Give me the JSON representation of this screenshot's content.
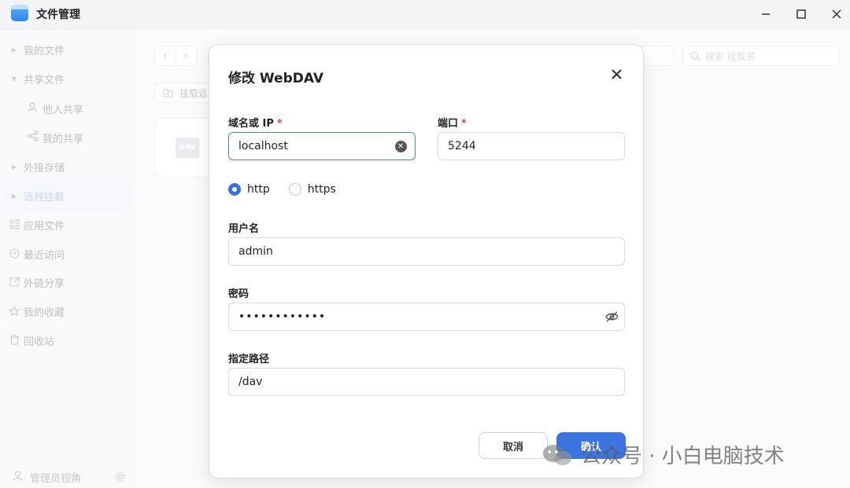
{
  "app": {
    "title": "文件管理"
  },
  "window_controls": {
    "minimize": "—",
    "maximize": "☐",
    "close": "✕"
  },
  "sidebar": {
    "items": [
      {
        "label": "我的文件",
        "icon": "chevron-right-icon",
        "indent": false,
        "active": false
      },
      {
        "label": "共享文件",
        "icon": "chevron-down-icon",
        "indent": false,
        "active": false
      },
      {
        "label": "他人共享",
        "icon": "users-icon",
        "indent": true,
        "active": false
      },
      {
        "label": "我的共享",
        "icon": "share-icon",
        "indent": true,
        "active": false
      },
      {
        "label": "外接存储",
        "icon": "chevron-right-icon",
        "indent": false,
        "active": false
      },
      {
        "label": "远程挂载",
        "icon": "chevron-right-icon",
        "indent": false,
        "active": true
      },
      {
        "label": "应用文件",
        "icon": "grid-icon",
        "indent": false,
        "active": false
      },
      {
        "label": "最近访问",
        "icon": "clock-icon",
        "indent": false,
        "active": false
      },
      {
        "label": "外链分享",
        "icon": "link-share-icon",
        "indent": false,
        "active": false
      },
      {
        "label": "我的收藏",
        "icon": "star-icon",
        "indent": false,
        "active": false
      },
      {
        "label": "回收站",
        "icon": "trash-icon",
        "indent": false,
        "active": false
      }
    ],
    "footer": {
      "label": "管理员视角",
      "icon": "user-icon",
      "settings_icon": "gear-icon"
    }
  },
  "main": {
    "search_placeholder": "搜索 挂载名",
    "mount_button_label": "挂载远",
    "card_icon_text": "DAV"
  },
  "dialog": {
    "title": "修改 WebDAV",
    "host": {
      "label": "域名或 IP",
      "required_mark": "*",
      "value": "localhost"
    },
    "port": {
      "label": "端口",
      "required_mark": "*",
      "value": "5244"
    },
    "protocol": {
      "options": [
        "http",
        "https"
      ],
      "selected": "http"
    },
    "username": {
      "label": "用户名",
      "value": "admin"
    },
    "password": {
      "label": "密码",
      "value": "••••••••••••"
    },
    "path": {
      "label": "指定路径",
      "value": "/dav"
    },
    "cancel_label": "取消",
    "confirm_label": "确认"
  },
  "watermark": {
    "text": "公众号 · 小白电脑技术"
  },
  "colors": {
    "accent": "#3c73de",
    "required": "#e0463e",
    "sidebar_bg": "#f3f4f6"
  }
}
